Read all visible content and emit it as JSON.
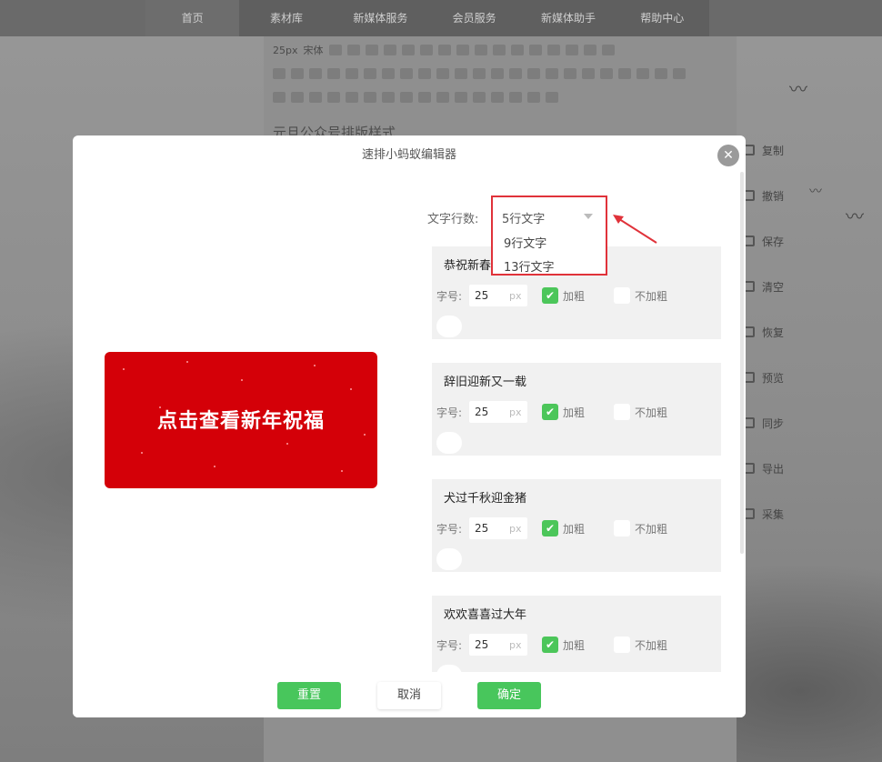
{
  "background": {
    "nav_items": [
      "首页",
      "素材库",
      "新媒体服务",
      "会员服务",
      "新媒体助手",
      "帮助中心"
    ],
    "active_nav": "首页",
    "toolbar_font_size": "25px",
    "toolbar_font_name": "宋体",
    "heading": "元旦公众号排版样式",
    "side_tools": [
      "复制",
      "撤销",
      "保存",
      "清空",
      "恢复",
      "预览",
      "同步",
      "导出",
      "采集"
    ]
  },
  "modal": {
    "title": "速排小蚂蚁编辑器",
    "close_icon": "close-icon",
    "preview_text": "点击查看新年祝福",
    "preview_color": "#d40008",
    "lines_label": "文字行数:",
    "dropdown": {
      "selected": "5行文字",
      "options": [
        "9行文字",
        "13行文字"
      ],
      "highlight_color": "#e0323a"
    },
    "rows": [
      {
        "title": "恭祝新春",
        "size_label": "字号:",
        "size_value": "25",
        "unit": "px",
        "bold_label": "加粗",
        "bold_checked": true,
        "nobold_label": "不加粗"
      },
      {
        "title": "辞旧迎新又一载",
        "size_label": "字号:",
        "size_value": "25",
        "unit": "px",
        "bold_label": "加粗",
        "bold_checked": true,
        "nobold_label": "不加粗"
      },
      {
        "title": "犬过千秋迎金猪",
        "size_label": "字号:",
        "size_value": "25",
        "unit": "px",
        "bold_label": "加粗",
        "bold_checked": true,
        "nobold_label": "不加粗"
      },
      {
        "title": "欢欢喜喜过大年",
        "size_label": "字号:",
        "size_value": "25",
        "unit": "px",
        "bold_label": "加粗",
        "bold_checked": true,
        "nobold_label": "不加粗"
      }
    ],
    "buttons": {
      "reset": "重置",
      "cancel": "取消",
      "confirm": "确定"
    },
    "accent_color": "#48c65c"
  }
}
